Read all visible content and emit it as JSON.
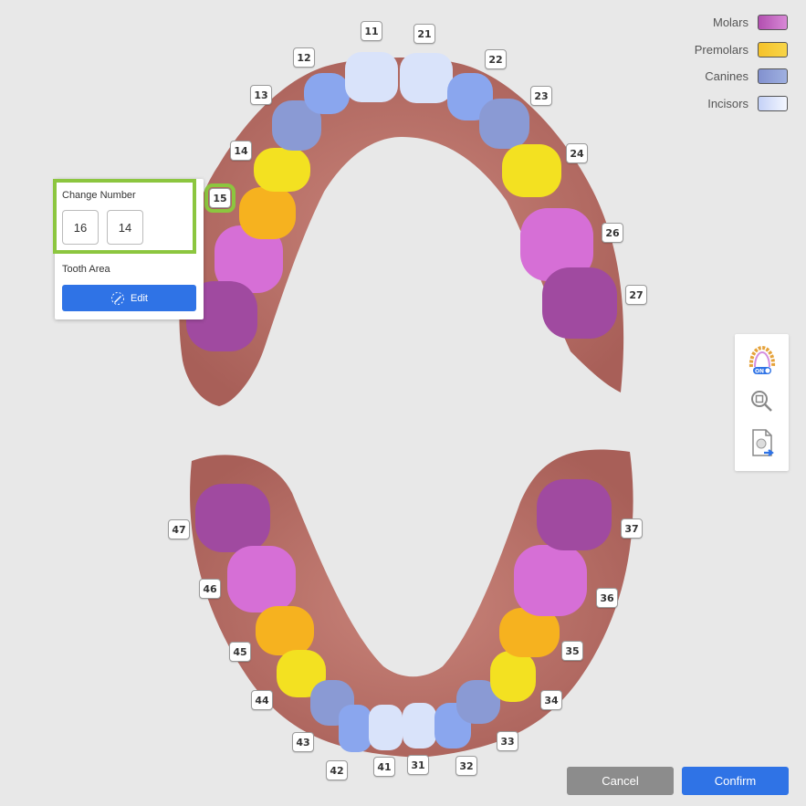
{
  "legend": [
    {
      "label": "Molars",
      "color": "#a04aa0"
    },
    {
      "label": "Premolars",
      "color": "#f5c92a"
    },
    {
      "label": "Canines",
      "color": "#8a9ad4"
    },
    {
      "label": "Incisors",
      "color": "#dfe6fb"
    }
  ],
  "colors": {
    "molar": "#a04aa0",
    "molar_light": "#d66fd6",
    "premolar_yellow": "#f3e121",
    "premolar_orange": "#f6b21f",
    "canine": "#8a9ad4",
    "lateral": "#8aa6ee",
    "incisor": "#d9e3fa",
    "gum": "#b96f68",
    "selection": "#8cc63f",
    "accent": "#2f73e6"
  },
  "teeth": {
    "t11": "11",
    "t12": "12",
    "t13": "13",
    "t14": "14",
    "t15": "15",
    "t21": "21",
    "t22": "22",
    "t23": "23",
    "t24": "24",
    "t26": "26",
    "t27": "27",
    "t31": "31",
    "t32": "32",
    "t33": "33",
    "t34": "34",
    "t35": "35",
    "t36": "36",
    "t37": "37",
    "t41": "41",
    "t42": "42",
    "t43": "43",
    "t44": "44",
    "t45": "45",
    "t46": "46",
    "t47": "47"
  },
  "popup": {
    "change_number_label": "Change Number",
    "options": [
      "16",
      "14"
    ],
    "tooth_area_label": "Tooth Area",
    "edit_label": "Edit"
  },
  "toolbar": {
    "arch_toggle_state": "ON",
    "icons": [
      "dental-arch-toggle-icon",
      "zoom-fit-icon",
      "export-model-icon"
    ]
  },
  "buttons": {
    "cancel_label": "Cancel",
    "confirm_label": "Confirm"
  }
}
